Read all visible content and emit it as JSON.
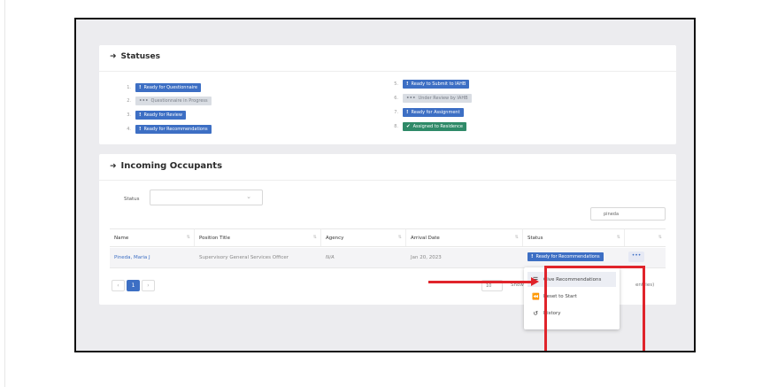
{
  "statuses_card": {
    "title": "Statuses",
    "items": [
      {
        "num": "1.",
        "label": "Ready for Questionnaire",
        "style": "blue",
        "icon": "!"
      },
      {
        "num": "2.",
        "label": "Questionnaire in Progress",
        "style": "grey",
        "icon": "•••"
      },
      {
        "num": "3.",
        "label": "Ready for Review",
        "style": "blue",
        "icon": "!"
      },
      {
        "num": "4.",
        "label": "Ready for Recommendations",
        "style": "blue",
        "icon": "!"
      },
      {
        "num": "5.",
        "label": "Ready to Submit to IAHB",
        "style": "blue",
        "icon": "!"
      },
      {
        "num": "6.",
        "label": "Under Review by IAHB",
        "style": "grey",
        "icon": "•••"
      },
      {
        "num": "7.",
        "label": "Ready for Assignment",
        "style": "blue",
        "icon": "!"
      },
      {
        "num": "8.",
        "label": "Assigned to Residence",
        "style": "green",
        "icon": "✔"
      }
    ]
  },
  "incoming_card": {
    "title": "Incoming Occupants",
    "filter_label": "Status",
    "filter_value": "",
    "search_value": "pineda",
    "columns": [
      "Name",
      "Position Title",
      "Agency",
      "Arrival Date",
      "Status",
      ""
    ],
    "rows": [
      {
        "name": "Pineda, Maria J",
        "position": "Supervisory General Services Officer",
        "agency": "N/A",
        "arrival": "Jan 20, 2023",
        "status": "Ready for Recommendations",
        "actions": "•••"
      }
    ],
    "pager": {
      "prev": "‹",
      "current": "1",
      "next": "›"
    },
    "page_size": "10",
    "showing_text": "Showing 1",
    "showing_tail": "entries)"
  },
  "context_menu": {
    "items": [
      {
        "label": "Give Recommendations",
        "icon": "list-icon"
      },
      {
        "label": "Reset to Start",
        "icon": "rewind-icon"
      },
      {
        "label": "History",
        "icon": "history-icon"
      }
    ]
  },
  "annotation": {
    "highlight_color": "#e0242b"
  },
  "colors": {
    "accent": "#3d6fc4",
    "success": "#2f8a68",
    "muted_badge": "#d9dde3"
  }
}
